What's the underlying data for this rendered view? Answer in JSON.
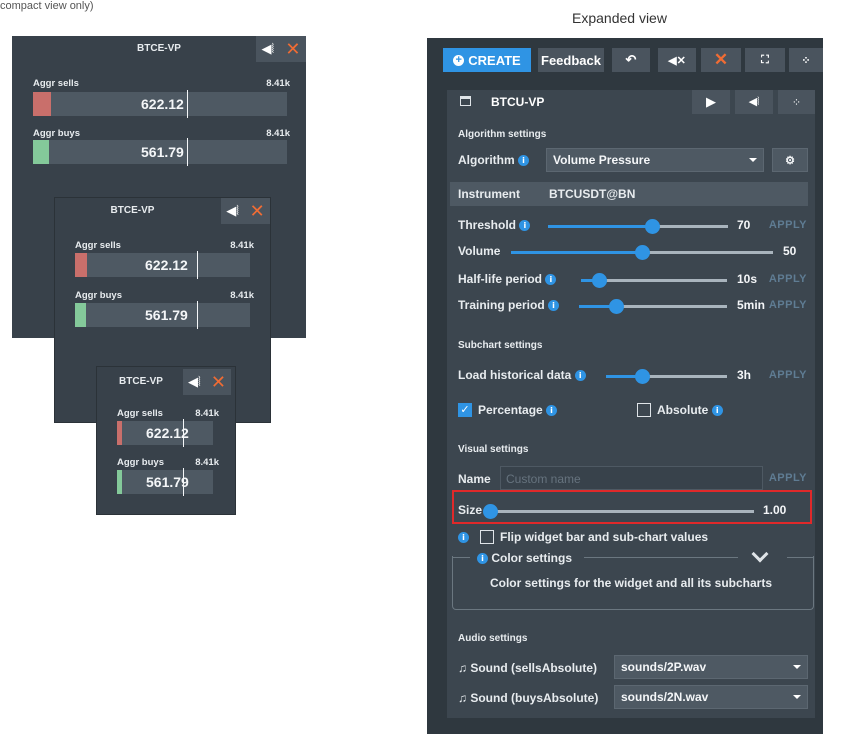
{
  "caption_top": "compact view only)",
  "expanded_title": "Expanded view",
  "widgets": [
    {
      "name": "BTCE-VP",
      "sells_label": "Aggr sells",
      "sells_count": "8.41k",
      "sells_value": "622.12",
      "buys_label": "Aggr buys",
      "buys_count": "8.41k",
      "buys_value": "561.79"
    },
    {
      "name": "BTCE-VP",
      "sells_label": "Aggr sells",
      "sells_count": "8.41k",
      "sells_value": "622.12",
      "buys_label": "Aggr buys",
      "buys_count": "8.41k",
      "buys_value": "561.79"
    },
    {
      "name": "BTCE-VP",
      "sells_label": "Aggr sells",
      "sells_count": "8.41k",
      "sells_value": "622.12",
      "buys_label": "Aggr buys",
      "buys_count": "8.41k",
      "buys_value": "561.79"
    }
  ],
  "toolbar": {
    "create": "CREATE",
    "feedback": "Feedback"
  },
  "inner": {
    "title": "BTCU-VP"
  },
  "algorithm": {
    "section": "Algorithm settings",
    "algorithm_label": "Algorithm",
    "algorithm_value": "Volume Pressure",
    "instrument_label": "Instrument",
    "instrument_value": "BTCUSDT@BN",
    "threshold_label": "Threshold",
    "threshold_value": "70",
    "threshold_level": 0.58,
    "volume_label": "Volume",
    "volume_value": "50",
    "volume_level": 0.5,
    "halflife_label": "Half-life period",
    "halflife_value": "10s",
    "halflife_level": 0.12,
    "training_label": "Training period",
    "training_value": "5min",
    "training_level": 0.25,
    "apply": "APPLY"
  },
  "subchart": {
    "section": "Subchart settings",
    "load_label": "Load historical data",
    "load_value": "3h",
    "load_level": 0.3,
    "percentage_label": "Percentage",
    "absolute_label": "Absolute"
  },
  "visual": {
    "section": "Visual settings",
    "name_label": "Name",
    "name_placeholder": "Custom name",
    "size_label": "Size",
    "size_value": "1.00",
    "size_level": 0.0,
    "flip_label": "Flip widget bar and sub-chart values",
    "color_title": "Color settings",
    "color_desc": "Color settings for the widget and all its subcharts"
  },
  "audio": {
    "section": "Audio settings",
    "sells_label": "Sound (sellsAbsolute)",
    "sells_value": "sounds/2P.wav",
    "buys_label": "Sound (buysAbsolute)",
    "buys_value": "sounds/2N.wav"
  },
  "colors": {
    "accent": "#2f94e4",
    "close": "#f06c34",
    "sell_fill": "#c96f6b",
    "buy_fill": "#84c99a",
    "highlight": "#e0292a"
  }
}
